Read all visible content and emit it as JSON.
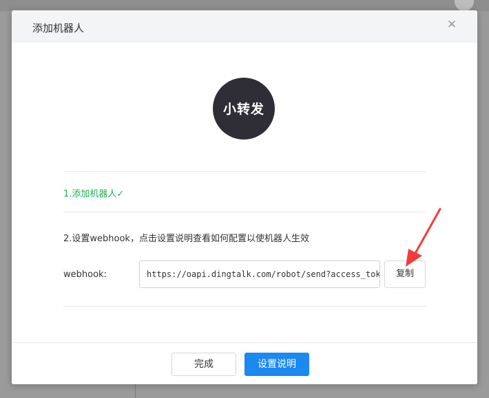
{
  "dialog": {
    "title": "添加机器人",
    "close_icon": "close-icon",
    "avatar_text": "小转发"
  },
  "steps": {
    "step1": "1.添加机器人✓",
    "step2": "2.设置webhook，点击设置说明查看如何配置以使机器人生效"
  },
  "webhook": {
    "label": "webhook:",
    "value": "https://oapi.dingtalk.com/robot/send?access_tok",
    "copy_label": "复制"
  },
  "footer": {
    "done_label": "完成",
    "guide_label": "设置说明"
  },
  "colors": {
    "accent": "#1a89f0",
    "success": "#1bb14f",
    "annotation_arrow": "#f23c3c"
  }
}
